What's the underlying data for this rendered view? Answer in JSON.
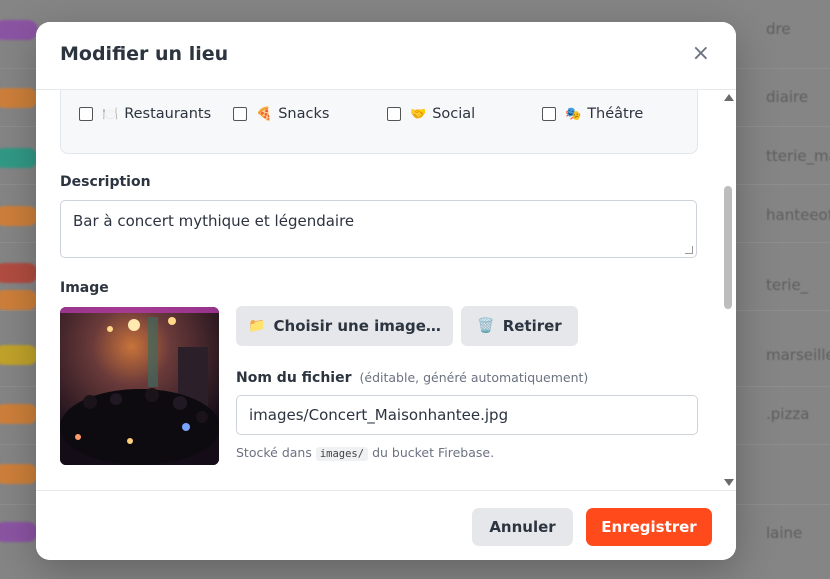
{
  "background": {
    "right_texts": [
      "dre",
      "diaire",
      "tterie_marse",
      "hanteeofficie",
      "terie_",
      "marseille",
      ".pizza",
      "laine"
    ],
    "pill_colors": [
      "#8e44ad",
      "#e67e22",
      "#16a085",
      "#e67e22",
      "#c0392b",
      "#e67e22",
      "#d4ac0d",
      "#e67e22",
      "#e67e22"
    ]
  },
  "modal": {
    "title": "Modifier un lieu",
    "close_symbol": "×",
    "categories": [
      {
        "label": "Restaurants",
        "emoji": "🍽️"
      },
      {
        "label": "Snacks",
        "emoji": "🍕"
      },
      {
        "label": "Social",
        "emoji": "🤝"
      },
      {
        "label": "Théâtre",
        "emoji": "🎭"
      }
    ],
    "description": {
      "label": "Description",
      "value": "Bar à concert mythique et légendaire"
    },
    "image": {
      "label": "Image",
      "choose_button": "Choisir une image…",
      "choose_icon": "📁",
      "remove_button": "Retirer",
      "remove_icon": "🗑️",
      "filename_label": "Nom du fichier",
      "filename_hint": "(éditable, généré automatiquement)",
      "filename_value": "images/Concert_Maisonhantee.jpg",
      "stored_prefix": "Stocké dans",
      "stored_code": "images/",
      "stored_suffix": "du bucket Firebase."
    },
    "footer": {
      "cancel": "Annuler",
      "save": "Enregistrer"
    },
    "accent_color": "#ff4a1c"
  }
}
